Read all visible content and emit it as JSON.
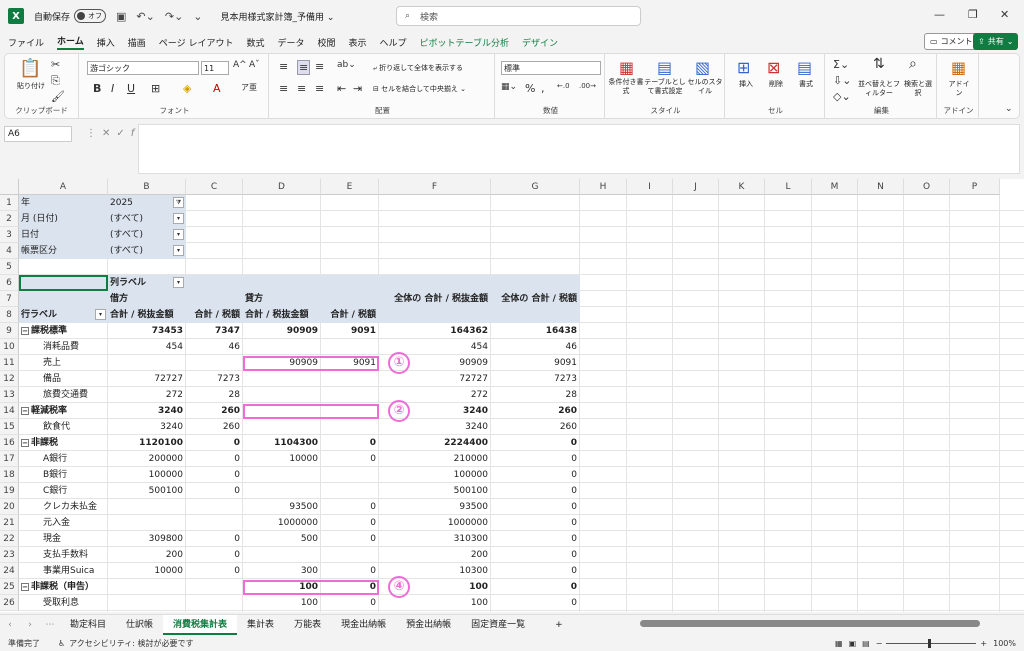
{
  "titlebar": {
    "autosave_label": "自動保存",
    "autosave_state": "オフ",
    "doc_title": "見本用様式家計簿_予備用 ⌄",
    "search_placeholder": "検索"
  },
  "menu": [
    "ファイル",
    "ホーム",
    "挿入",
    "描画",
    "ページ レイアウト",
    "数式",
    "データ",
    "校閲",
    "表示",
    "ヘルプ",
    "ピボットテーブル分析",
    "デザイン"
  ],
  "menu_active_index": 1,
  "comment_label": "コメント",
  "share_label": "共有",
  "ribbon": {
    "clipboard": {
      "paste": "貼り付け",
      "label": "クリップボード"
    },
    "font": {
      "name": "游ゴシック",
      "size": "11",
      "label": "フォント"
    },
    "alignment": {
      "wrap": "折り返して全体を表示する",
      "merge": "セルを結合して中央揃え",
      "label": "配置"
    },
    "number": {
      "format": "標準",
      "label": "数値"
    },
    "styles": {
      "conditional": "条件付き書式",
      "table": "テーブルとして書式設定",
      "cellstyle": "セルのスタイル",
      "label": "スタイル"
    },
    "cells": {
      "insert": "挿入",
      "delete": "削除",
      "format": "書式",
      "label": "セル"
    },
    "editing": {
      "sort": "並べ替えとフィルター",
      "find": "検索と選択",
      "label": "編集"
    },
    "addins": {
      "addin": "アドイン",
      "label": "アドイン"
    }
  },
  "namebox": "A6",
  "columns": [
    "A",
    "B",
    "C",
    "D",
    "E",
    "F",
    "G",
    "H",
    "I",
    "J",
    "K",
    "L",
    "M",
    "N",
    "O",
    "P"
  ],
  "rows": [
    "1",
    "2",
    "3",
    "4",
    "5",
    "6",
    "7",
    "8",
    "9",
    "10",
    "11",
    "12",
    "13",
    "14",
    "15",
    "16",
    "17",
    "18",
    "19",
    "20",
    "21",
    "22",
    "23",
    "24",
    "25",
    "26"
  ],
  "filters": [
    {
      "label": "年",
      "value": "2025"
    },
    {
      "label": "月 (日付)",
      "value": "(すべて)"
    },
    {
      "label": "日付",
      "value": "(すべて)"
    },
    {
      "label": "帳票区分",
      "value": "(すべて)"
    }
  ],
  "pivot_header": {
    "col_label": "列ラベル",
    "debit": "借方",
    "credit": "貸方",
    "row_label": "行ラベル",
    "debit_excl": "合計 / 税抜金額",
    "debit_tax": "合計 / 税額",
    "credit_excl": "合計 / 税抜金額",
    "credit_tax": "合計 / 税額",
    "total_excl": "全体の 合計 / 税抜金額",
    "total_tax": "全体の 合計 / 税額"
  },
  "pivot_rows": [
    {
      "label": "課税標準",
      "group": true,
      "b": "73453",
      "c": "7347",
      "d": "90909",
      "e": "9091",
      "f": "164362",
      "g": "16438"
    },
    {
      "label": "消耗品費",
      "group": false,
      "b": "454",
      "c": "46",
      "d": "",
      "e": "",
      "f": "454",
      "g": "46"
    },
    {
      "label": "売上",
      "group": false,
      "b": "",
      "c": "",
      "d": "90909",
      "e": "9091",
      "f": "90909",
      "g": "9091"
    },
    {
      "label": "備品",
      "group": false,
      "b": "72727",
      "c": "7273",
      "d": "",
      "e": "",
      "f": "72727",
      "g": "7273"
    },
    {
      "label": "旅費交通費",
      "group": false,
      "b": "272",
      "c": "28",
      "d": "",
      "e": "",
      "f": "272",
      "g": "28"
    },
    {
      "label": "軽減税率",
      "group": true,
      "b": "3240",
      "c": "260",
      "d": "",
      "e": "",
      "f": "3240",
      "g": "260"
    },
    {
      "label": "飲食代",
      "group": false,
      "b": "3240",
      "c": "260",
      "d": "",
      "e": "",
      "f": "3240",
      "g": "260"
    },
    {
      "label": "非課税",
      "group": true,
      "b": "1120100",
      "c": "0",
      "d": "1104300",
      "e": "0",
      "f": "2224400",
      "g": "0"
    },
    {
      "label": "A銀行",
      "group": false,
      "b": "200000",
      "c": "0",
      "d": "10000",
      "e": "0",
      "f": "210000",
      "g": "0"
    },
    {
      "label": "B銀行",
      "group": false,
      "b": "100000",
      "c": "0",
      "d": "",
      "e": "",
      "f": "100000",
      "g": "0"
    },
    {
      "label": "C銀行",
      "group": false,
      "b": "500100",
      "c": "0",
      "d": "",
      "e": "",
      "f": "500100",
      "g": "0"
    },
    {
      "label": "クレカ未払金",
      "group": false,
      "b": "",
      "c": "",
      "d": "93500",
      "e": "0",
      "f": "93500",
      "g": "0"
    },
    {
      "label": "元入金",
      "group": false,
      "b": "",
      "c": "",
      "d": "1000000",
      "e": "0",
      "f": "1000000",
      "g": "0"
    },
    {
      "label": "現金",
      "group": false,
      "b": "309800",
      "c": "0",
      "d": "500",
      "e": "0",
      "f": "310300",
      "g": "0"
    },
    {
      "label": "支払手数料",
      "group": false,
      "b": "200",
      "c": "0",
      "d": "",
      "e": "",
      "f": "200",
      "g": "0"
    },
    {
      "label": "事業用Suica",
      "group": false,
      "b": "10000",
      "c": "0",
      "d": "300",
      "e": "0",
      "f": "10300",
      "g": "0"
    },
    {
      "label": "非課税（申告）",
      "group": true,
      "b": "",
      "c": "",
      "d": "100",
      "e": "0",
      "f": "100",
      "g": "0"
    },
    {
      "label": "受取利息",
      "group": false,
      "b": "",
      "c": "",
      "d": "100",
      "e": "0",
      "f": "100",
      "g": "0"
    }
  ],
  "annotations": [
    "①",
    "②",
    "④"
  ],
  "sheet_tabs": [
    "勘定科目",
    "仕訳帳",
    "消費税集計表",
    "集計表",
    "万能表",
    "現金出納帳",
    "預金出納帳",
    "固定資産一覧"
  ],
  "sheet_active_index": 2,
  "status": {
    "ready": "準備完了",
    "accessibility": "アクセシビリティ: 検討が必要です",
    "zoom": "100%"
  },
  "colors": {
    "accent": "#107c41",
    "pivot_header_bg": "#dbe3ef",
    "highlight": "#f06bd8"
  }
}
